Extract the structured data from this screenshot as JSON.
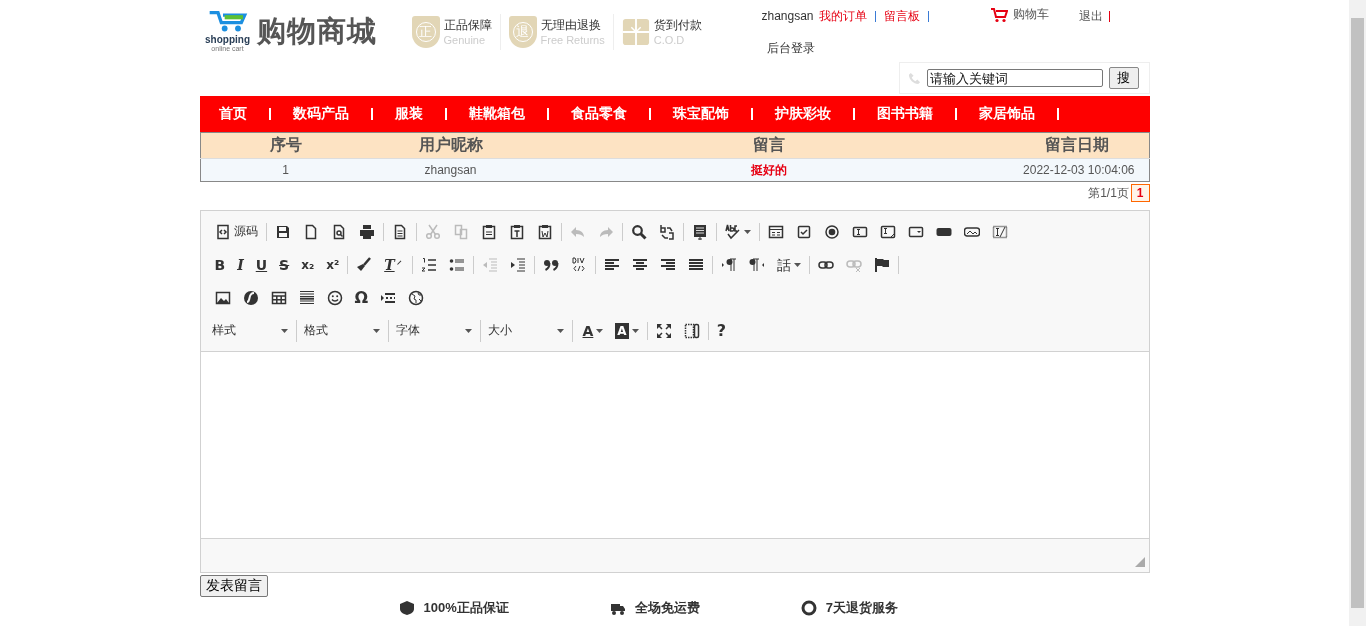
{
  "header": {
    "logo": {
      "wordmark": "shopping",
      "tagline": "online cart",
      "title": "购物商城"
    },
    "badges": [
      {
        "kind": "shield",
        "glyph": "正",
        "title": "正品保障",
        "subtitle": "Genuine"
      },
      {
        "kind": "shield",
        "glyph": "退",
        "title": "无理由退换",
        "subtitle": "Free Returns"
      },
      {
        "kind": "gift",
        "title": "货到付款",
        "subtitle": "C.O.D"
      }
    ],
    "user": {
      "name": "zhangsan",
      "links": [
        {
          "label": "我的订单"
        },
        {
          "label": "留言板"
        }
      ],
      "admin": "后台登录"
    },
    "cart": "购物车",
    "logout": "退出"
  },
  "search": {
    "placeholder": "请输入关键词",
    "button": "搜"
  },
  "nav": [
    {
      "label": "首页"
    },
    {
      "label": "数码产品"
    },
    {
      "label": "服装"
    },
    {
      "label": "鞋靴箱包"
    },
    {
      "label": "食品零食"
    },
    {
      "label": "珠宝配饰"
    },
    {
      "label": "护肤彩妆"
    },
    {
      "label": "图书书籍"
    },
    {
      "label": "家居饰品"
    }
  ],
  "table": {
    "columns": [
      "序号",
      "用户昵称",
      "留言",
      "留言日期"
    ],
    "rows": [
      [
        "1",
        "zhangsan",
        "挺好的",
        "2022-12-03 10:04:06"
      ]
    ]
  },
  "pager": {
    "summary": "第1/1页",
    "pages": [
      {
        "label": "1",
        "selected": true
      }
    ]
  },
  "editor": {
    "toolbar": [
      [
        {
          "kind": "source",
          "text": "源码",
          "disabled": false
        },
        {
          "kind": "separator"
        },
        {
          "kind": "save",
          "disabled": false
        },
        {
          "kind": "newpage",
          "disabled": false
        },
        {
          "kind": "preview",
          "disabled": false
        },
        {
          "kind": "print",
          "disabled": false
        },
        {
          "kind": "separator"
        },
        {
          "kind": "templates",
          "disabled": false
        },
        {
          "kind": "separator"
        },
        {
          "kind": "cut",
          "disabled": true
        },
        {
          "kind": "copy",
          "disabled": true
        },
        {
          "kind": "paste",
          "disabled": false
        },
        {
          "kind": "pastetext",
          "disabled": false
        },
        {
          "kind": "pasteword",
          "disabled": false
        },
        {
          "kind": "separator"
        },
        {
          "kind": "undo",
          "disabled": true
        },
        {
          "kind": "redo",
          "disabled": true
        },
        {
          "kind": "separator"
        },
        {
          "kind": "find",
          "disabled": false
        },
        {
          "kind": "replace",
          "disabled": false
        },
        {
          "kind": "separator"
        },
        {
          "kind": "selectall",
          "disabled": false
        },
        {
          "kind": "separator"
        },
        {
          "kind": "spellcheck",
          "disabled": false
        },
        {
          "kind": "separator"
        },
        {
          "kind": "form",
          "disabled": false
        },
        {
          "kind": "checkbox",
          "disabled": false
        },
        {
          "kind": "radio",
          "disabled": false
        },
        {
          "kind": "textfield",
          "disabled": false
        },
        {
          "kind": "textarea",
          "disabled": false
        },
        {
          "kind": "select",
          "disabled": false
        },
        {
          "kind": "button",
          "disabled": false
        },
        {
          "kind": "imagebutton",
          "disabled": false
        },
        {
          "kind": "hiddenfield",
          "disabled": false
        }
      ],
      [
        {
          "kind": "bold",
          "text": "B",
          "disabled": false
        },
        {
          "kind": "italic",
          "text": "I",
          "disabled": false
        },
        {
          "kind": "underline",
          "text": "U",
          "disabled": false
        },
        {
          "kind": "strike",
          "text": "S",
          "disabled": false
        },
        {
          "kind": "subscript",
          "text": "x₂",
          "disabled": false
        },
        {
          "kind": "superscript",
          "text": "x²",
          "disabled": false
        },
        {
          "kind": "separator"
        },
        {
          "kind": "copyformat",
          "disabled": false
        },
        {
          "kind": "removeformat",
          "text": "T",
          "disabled": false
        },
        {
          "kind": "separator"
        },
        {
          "kind": "numbered",
          "disabled": false
        },
        {
          "kind": "bulleted",
          "disabled": false
        },
        {
          "kind": "separator"
        },
        {
          "kind": "outdent",
          "disabled": true
        },
        {
          "kind": "indent",
          "disabled": false
        },
        {
          "kind": "separator"
        },
        {
          "kind": "blockquote",
          "disabled": false
        },
        {
          "kind": "creatediv",
          "disabled": false
        },
        {
          "kind": "separator"
        },
        {
          "kind": "alignleft",
          "disabled": false
        },
        {
          "kind": "aligncenter",
          "disabled": false
        },
        {
          "kind": "alignright",
          "disabled": false
        },
        {
          "kind": "justify",
          "disabled": false
        },
        {
          "kind": "separator"
        },
        {
          "kind": "ltr",
          "disabled": false
        },
        {
          "kind": "rtl",
          "disabled": false
        },
        {
          "kind": "language",
          "text": "話",
          "disabled": false
        },
        {
          "kind": "separator"
        },
        {
          "kind": "link",
          "disabled": false
        },
        {
          "kind": "unlink",
          "disabled": true
        },
        {
          "kind": "anchor",
          "disabled": false
        },
        {
          "kind": "separator"
        }
      ],
      [
        {
          "kind": "image",
          "disabled": false
        },
        {
          "kind": "flash",
          "disabled": false
        },
        {
          "kind": "table",
          "disabled": false
        },
        {
          "kind": "hr",
          "disabled": false
        },
        {
          "kind": "smiley",
          "disabled": false
        },
        {
          "kind": "specialchar",
          "text": "Ω",
          "disabled": false
        },
        {
          "kind": "pagebreak",
          "disabled": false
        },
        {
          "kind": "iframe",
          "disabled": false
        }
      ],
      [
        {
          "kind": "combo",
          "text": "样式",
          "disabled": false
        },
        {
          "kind": "combo",
          "text": "格式",
          "disabled": false
        },
        {
          "kind": "combo",
          "text": "字体",
          "disabled": false
        },
        {
          "kind": "combo",
          "text": "大小",
          "disabled": false
        },
        {
          "kind": "textcolor",
          "text": "A",
          "disabled": false
        },
        {
          "kind": "bgcolor",
          "text": "A",
          "disabled": false
        },
        {
          "kind": "separator"
        },
        {
          "kind": "maximize",
          "disabled": false
        },
        {
          "kind": "showblocks",
          "disabled": false
        },
        {
          "kind": "separator"
        },
        {
          "kind": "about",
          "text": "?",
          "disabled": false
        }
      ]
    ]
  },
  "submit": "发表留言",
  "footer": [
    {
      "kind": "shield",
      "label": "100%正品保证"
    },
    {
      "kind": "truck",
      "label": "全场免运费"
    },
    {
      "kind": "return",
      "label": "7天退货服务"
    }
  ]
}
